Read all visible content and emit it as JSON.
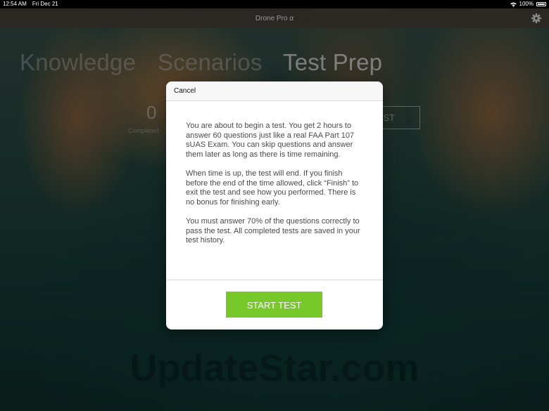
{
  "status_bar": {
    "time": "12:54 AM",
    "date": "Fri Dec 21",
    "battery": "100%"
  },
  "nav": {
    "title": "Drone Pro α"
  },
  "segments": [
    "Knowledge",
    "Scenarios",
    "Test Prep"
  ],
  "background": {
    "completed_count": "0",
    "completed_label": "Completed",
    "button_label_partial": "ST",
    "watermark": "UpdateStar.com"
  },
  "modal": {
    "cancel_label": "Cancel",
    "paragraphs": [
      "You are about to begin a test. You get 2 hours to answer 60 questions just like a real FAA Part 107 sUAS Exam. You can skip questions and answer them later as long as there is time remaining.",
      "When time is up, the test will end. If you finish before the end of the time allowed, click “Finish” to exit the test and see how you performed. There is no bonus for finishing early.",
      "You must answer 70% of the questions correctly to pass the test. All completed tests are saved in your test history."
    ],
    "start_label": "START TEST"
  },
  "colors": {
    "accent_green": "#77c829",
    "status_bar": "#000000",
    "nav_bar": "#2d2823"
  }
}
